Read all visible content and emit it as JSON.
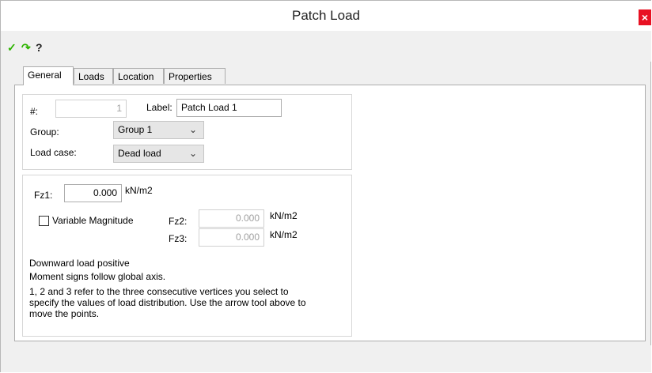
{
  "window": {
    "title": "Patch Load",
    "close_glyph": "×"
  },
  "toolbar": {
    "ok_icon": "checkmark-icon",
    "apply_icon": "redo-arrow-icon",
    "help_icon": "help-icon",
    "ok_glyph": "✓",
    "apply_glyph": "↷",
    "help_glyph": "?"
  },
  "tabs": [
    {
      "label": "General",
      "active": true
    },
    {
      "label": "Loads",
      "active": false
    },
    {
      "label": "Location",
      "active": false
    },
    {
      "label": "Properties",
      "active": false
    }
  ],
  "general": {
    "number_label": "#:",
    "number_value": "1",
    "name_label": "Label:",
    "name_value": "Patch Load 1",
    "group_label": "Group:",
    "group_value": "Group 1",
    "loadcase_label": "Load case:",
    "loadcase_value": "Dead load"
  },
  "loads": {
    "fz1_label": "Fz1:",
    "fz1_value": "0.000",
    "fz1_unit": "kN/m2",
    "variable_label": "Variable Magnitude",
    "variable_checked": false,
    "fz2_label": "Fz2:",
    "fz2_value": "0.000",
    "fz2_unit": "kN/m2",
    "fz3_label": "Fz3:",
    "fz3_value": "0.000",
    "fz3_unit": "kN/m2"
  },
  "help": {
    "line1": "Downward load positive",
    "line2": "Moment signs follow global axis.",
    "para": "1, 2 and 3 refer to the three consecutive vertices you select to specify the values of load distribution. Use the arrow tool above to move the points."
  },
  "colors": {
    "ok": "#2db400",
    "apply": "#2db400",
    "close_bg": "#e81123"
  }
}
